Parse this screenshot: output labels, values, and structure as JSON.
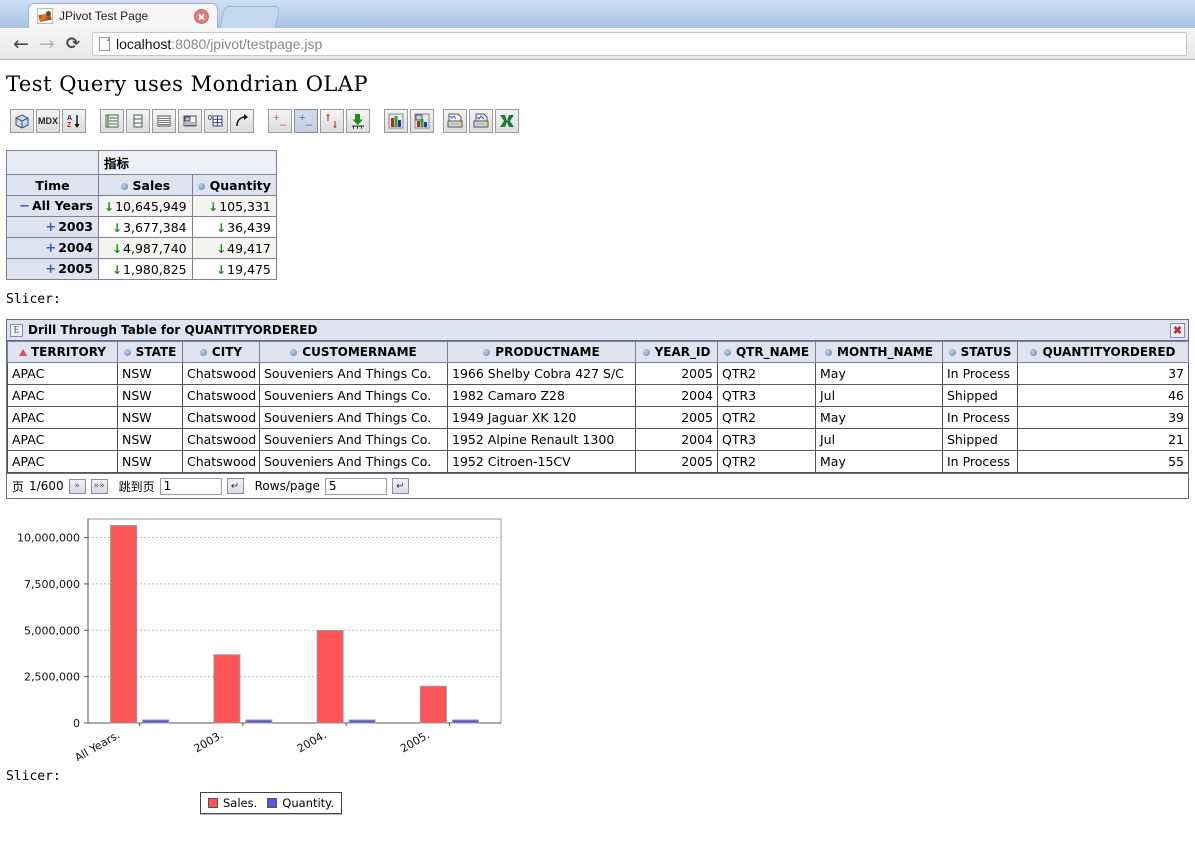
{
  "browser": {
    "tab_title": "JPivot Test Page",
    "favicon": "jpivot-favicon",
    "close_icon": "close-icon",
    "new_tab_icon": "new-tab-icon",
    "back_icon": "back-arrow-icon",
    "forward_icon": "forward-arrow-icon",
    "reload_icon": "reload-icon",
    "page_icon": "page-document-icon",
    "url_host": "localhost",
    "url_rest": ":8080/jpivot/testpage.jsp"
  },
  "page": {
    "title": "Test Query uses Mondrian OLAP",
    "slicer_label_top": "Slicer:",
    "slicer_label_bottom": "Slicer:"
  },
  "toolbar": {
    "buttons": [
      {
        "name": "cube-navigator-button",
        "label": "",
        "icon": "cube-icon",
        "pressed": false
      },
      {
        "name": "mdx-query-button",
        "label": "MDX",
        "icon": "mdx-icon",
        "pressed": false
      },
      {
        "name": "sort-configuration-button",
        "label": "",
        "icon": "sort-az-icon",
        "pressed": false
      },
      {
        "name": "level-style-button",
        "label": "",
        "icon": "hierarchy-icon",
        "pressed": false
      },
      {
        "name": "hide-spans-button",
        "label": "",
        "icon": "columns-icon",
        "pressed": false
      },
      {
        "name": "properties-button",
        "label": "",
        "icon": "rows-icon",
        "pressed": false
      },
      {
        "name": "suppress-empty-button",
        "label": "",
        "icon": "table-edit-icon",
        "pressed": false
      },
      {
        "name": "show-parents-button",
        "label": "",
        "icon": "zero-grid-icon",
        "pressed": false
      },
      {
        "name": "swap-axes-button",
        "label": "",
        "icon": "swap-axes-icon",
        "pressed": false
      },
      {
        "name": "drill-member-button",
        "label": "",
        "icon": "plus-minus-red-icon",
        "pressed": false
      },
      {
        "name": "drill-position-button",
        "label": "",
        "icon": "plus-minus-blue-icon",
        "pressed": true
      },
      {
        "name": "drill-replace-button",
        "label": "",
        "icon": "up-down-arrows-icon",
        "pressed": false
      },
      {
        "name": "drill-through-button",
        "label": "",
        "icon": "drill-through-icon",
        "pressed": false
      },
      {
        "name": "chart-show-button",
        "label": "",
        "icon": "bar-chart-icon",
        "pressed": false
      },
      {
        "name": "chart-config-button",
        "label": "",
        "icon": "chart-config-icon",
        "pressed": false
      },
      {
        "name": "print-config-button",
        "label": "",
        "icon": "print-setup-icon",
        "pressed": false
      },
      {
        "name": "print-pdf-button",
        "label": "",
        "icon": "print-pdf-icon",
        "pressed": false
      },
      {
        "name": "export-excel-button",
        "label": "",
        "icon": "excel-export-icon",
        "pressed": false
      }
    ]
  },
  "pivot": {
    "measures_header": "指标",
    "row_axis_header": "Time",
    "columns": [
      "Sales",
      "Quantity"
    ],
    "rows": [
      {
        "expander": "−",
        "label": "All Years",
        "values": [
          "10,645,949",
          "105,331"
        ]
      },
      {
        "expander": "+",
        "label": "2003",
        "values": [
          "3,677,384",
          "36,439"
        ]
      },
      {
        "expander": "+",
        "label": "2004",
        "values": [
          "4,987,740",
          "49,417"
        ]
      },
      {
        "expander": "+",
        "label": "2005",
        "values": [
          "1,980,825",
          "19,475"
        ]
      }
    ]
  },
  "drill_through": {
    "title": "Drill Through Table for QUANTITYORDERED",
    "panel_icon": "expand-panel-icon",
    "close_icon": "close-x-icon",
    "columns": [
      {
        "label": "TERRITORY",
        "sorted": true,
        "marker": "sort-asc-triangle-icon"
      },
      {
        "label": "STATE",
        "sorted": false,
        "marker": "column-dot-icon"
      },
      {
        "label": "CITY",
        "sorted": false,
        "marker": "column-dot-icon"
      },
      {
        "label": "CUSTOMERNAME",
        "sorted": false,
        "marker": "column-dot-icon"
      },
      {
        "label": "PRODUCTNAME",
        "sorted": false,
        "marker": "column-dot-icon"
      },
      {
        "label": "YEAR_ID",
        "sorted": false,
        "marker": "column-dot-icon"
      },
      {
        "label": "QTR_NAME",
        "sorted": false,
        "marker": "column-dot-icon"
      },
      {
        "label": "MONTH_NAME",
        "sorted": false,
        "marker": "column-dot-icon"
      },
      {
        "label": "STATUS",
        "sorted": false,
        "marker": "column-dot-icon"
      },
      {
        "label": "QUANTITYORDERED",
        "sorted": false,
        "marker": "column-dot-icon"
      }
    ],
    "rows": [
      [
        "APAC",
        "NSW",
        "Chatswood",
        "Souveniers And Things Co.",
        "1966 Shelby Cobra 427 S/C",
        "2005",
        "QTR2",
        "May",
        "In Process",
        "37"
      ],
      [
        "APAC",
        "NSW",
        "Chatswood",
        "Souveniers And Things Co.",
        "1982 Camaro Z28",
        "2004",
        "QTR3",
        "Jul",
        "Shipped",
        "46"
      ],
      [
        "APAC",
        "NSW",
        "Chatswood",
        "Souveniers And Things Co.",
        "1949 Jaguar XK 120",
        "2005",
        "QTR2",
        "May",
        "In Process",
        "39"
      ],
      [
        "APAC",
        "NSW",
        "Chatswood",
        "Souveniers And Things Co.",
        "1952 Alpine Renault 1300",
        "2004",
        "QTR3",
        "Jul",
        "Shipped",
        "21"
      ],
      [
        "APAC",
        "NSW",
        "Chatswood",
        "Souveniers And Things Co.",
        "1952 Citroen-15CV",
        "2005",
        "QTR2",
        "May",
        "In Process",
        "55"
      ]
    ],
    "footer": {
      "page_label": "页",
      "page_value": "1/600",
      "next_icon": "next-page-icon",
      "last_icon": "last-page-icon",
      "goto_label": "跳到页",
      "goto_value": "1",
      "goto_submit_icon": "enter-key-icon",
      "rows_label": "Rows/page",
      "rows_value": "5",
      "rows_submit_icon": "enter-key-icon"
    }
  },
  "chart_data": {
    "type": "bar",
    "title": "",
    "xlabel": "",
    "ylabel": "",
    "categories": [
      "All Years.",
      "2003.",
      "2004.",
      "2005."
    ],
    "series": [
      {
        "name": "Sales.",
        "color": "#fc5457",
        "values": [
          10645949,
          3677384,
          4987740,
          1980825
        ]
      },
      {
        "name": "Quantity.",
        "color": "#5555dd",
        "values": [
          105331,
          36439,
          49417,
          19475
        ]
      }
    ],
    "ylim": [
      0,
      11000000
    ],
    "yticks": [
      0,
      2500000,
      5000000,
      7500000,
      10000000
    ],
    "ytick_labels": [
      "0",
      "2,500,000",
      "5,000,000",
      "7,500,000",
      "10,000,000"
    ],
    "grid": true,
    "legend_position": "bottom"
  }
}
